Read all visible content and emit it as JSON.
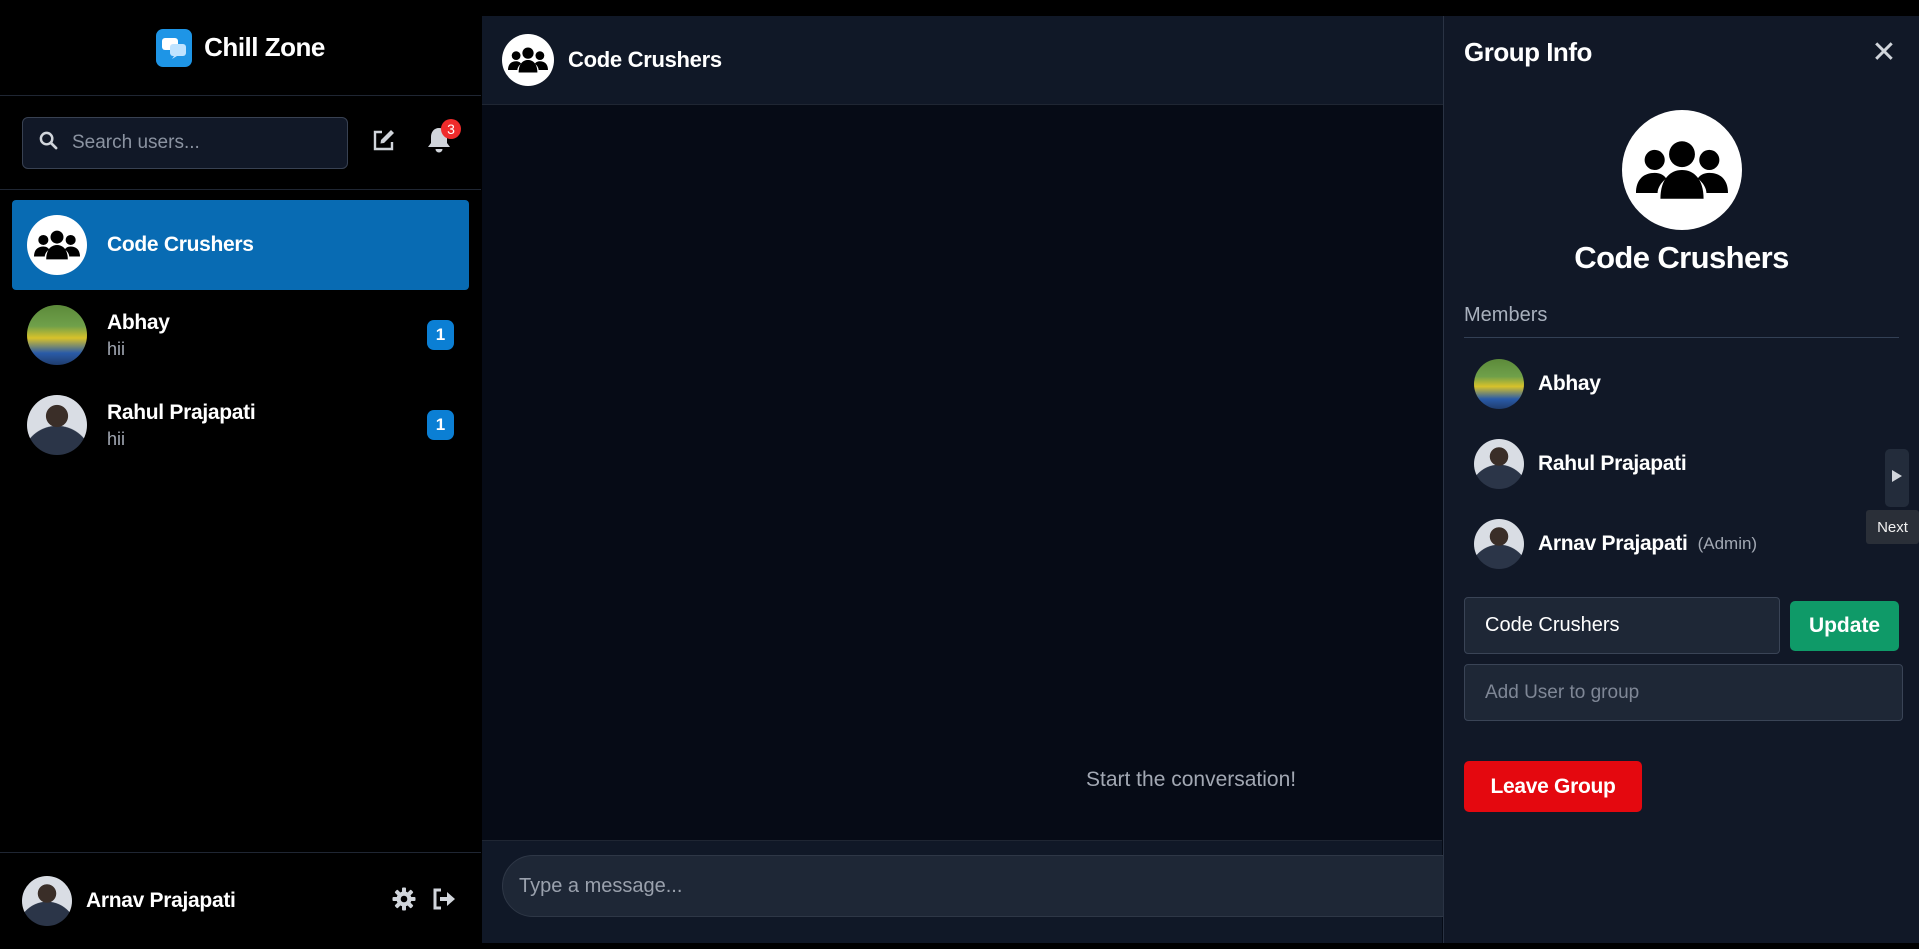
{
  "app": {
    "name": "Chill Zone",
    "accent": "#1e95e6"
  },
  "search": {
    "placeholder": "Search users..."
  },
  "notifications": {
    "count": "3"
  },
  "chats": [
    {
      "name": "Code Crushers",
      "last": "",
      "unread": "",
      "active": true,
      "avatar": "group-icon"
    },
    {
      "name": "Abhay",
      "last": "hii",
      "unread": "1",
      "active": false,
      "avatar": "user-photo"
    },
    {
      "name": "Rahul Prajapati",
      "last": "hii",
      "unread": "1",
      "active": false,
      "avatar": "user-photo"
    }
  ],
  "current_user": {
    "name": "Arnav Prajapati"
  },
  "chat": {
    "title": "Code Crushers",
    "empty_text": "Start the conversation!",
    "composer_placeholder": "Type a message..."
  },
  "group_info": {
    "title": "Group Info",
    "close_label": "✕",
    "group_name": "Code Crushers",
    "members_label": "Members",
    "members": [
      {
        "name": "Abhay",
        "role": ""
      },
      {
        "name": "Rahul Prajapati",
        "role": ""
      },
      {
        "name": "Arnav Prajapati",
        "role": "(Admin)"
      }
    ],
    "name_input_value": "Code Crushers",
    "update_label": "Update",
    "add_user_placeholder": "Add User to group",
    "leave_label": "Leave Group",
    "leave_color": "#e4080f",
    "update_color": "#0f9a68"
  },
  "tooltip": {
    "text": "Next"
  }
}
